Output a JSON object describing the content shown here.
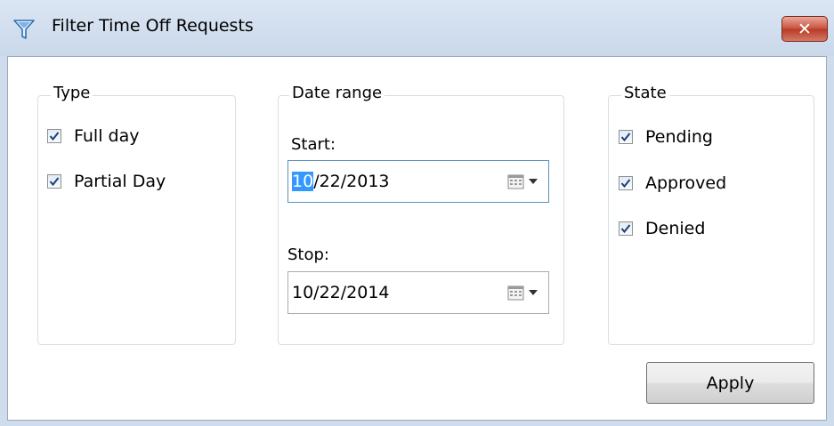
{
  "window": {
    "title": "Filter Time Off Requests",
    "close_glyph": "✕",
    "icon": "filter-funnel-icon"
  },
  "type_group": {
    "label": "Type",
    "items": [
      {
        "label": "Full day",
        "checked": true
      },
      {
        "label": "Partial Day",
        "checked": true
      }
    ]
  },
  "date_group": {
    "label": "Date range",
    "start": {
      "label": "Start:",
      "value_selected": "10",
      "value_rest": "/22/2013"
    },
    "stop": {
      "label": "Stop:",
      "value": "10/22/2014"
    }
  },
  "state_group": {
    "label": "State",
    "items": [
      {
        "label": "Pending",
        "checked": true
      },
      {
        "label": "Approved",
        "checked": true
      },
      {
        "label": "Denied",
        "checked": true
      }
    ]
  },
  "actions": {
    "apply_label": "Apply"
  },
  "colors": {
    "titlebar": "#c9d8ea",
    "close_button": "#c9503c",
    "selection": "#3399ff",
    "group_border": "#d5dfe5",
    "checkmark": "#1d3f7a"
  }
}
